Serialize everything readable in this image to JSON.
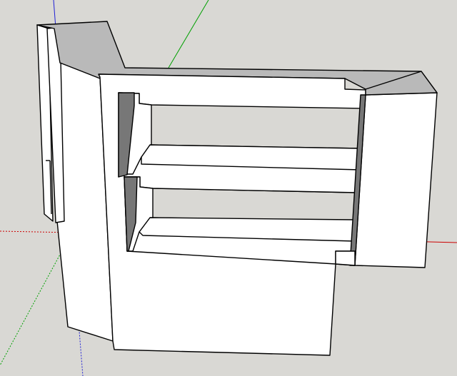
{
  "app": {
    "type": "3d-modeling-viewport"
  },
  "viewport": {
    "background_color": "#d9d8d4",
    "axes": {
      "red_axis_color": "#cc0000",
      "green_axis_color": "#00a000",
      "blue_axis_color": "#1f1fd6"
    }
  },
  "model": {
    "face_white": "#ffffff",
    "face_gray": "#b9b9b9",
    "face_dark": "#777777",
    "edge_color": "#000000"
  }
}
